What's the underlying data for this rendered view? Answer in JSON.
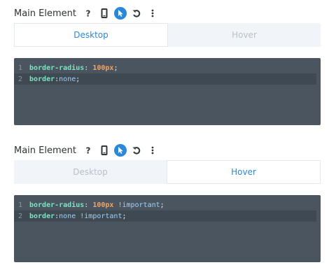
{
  "sections": [
    {
      "title": "Main Element",
      "tabs": {
        "desktop": "Desktop",
        "hover": "Hover",
        "selected": "desktop"
      },
      "code": [
        {
          "line": "1",
          "prop": "border-radius",
          "colon": ": ",
          "value": "100px",
          "extra": "",
          "end": ";"
        },
        {
          "line": "2",
          "prop": "border",
          "colon": ":",
          "value": "none",
          "extra": "",
          "end": ";"
        }
      ]
    },
    {
      "title": "Main Element",
      "tabs": {
        "desktop": "Desktop",
        "hover": "Hover",
        "selected": "hover"
      },
      "code": [
        {
          "line": "1",
          "prop": "border-radius",
          "colon": ": ",
          "value": "100px",
          "extra": " !important",
          "end": ";"
        },
        {
          "line": "2",
          "prop": "border",
          "colon": ":",
          "value": "none",
          "extra": " !important",
          "end": ";"
        }
      ]
    }
  ],
  "icons": [
    "help-icon",
    "mobile-icon",
    "cursor-icon",
    "undo-icon",
    "more-icon"
  ],
  "colors": {
    "accent": "#2b87da",
    "editor_bg": "#4a555f",
    "tab_inactive_bg": "#f1f5f9"
  }
}
